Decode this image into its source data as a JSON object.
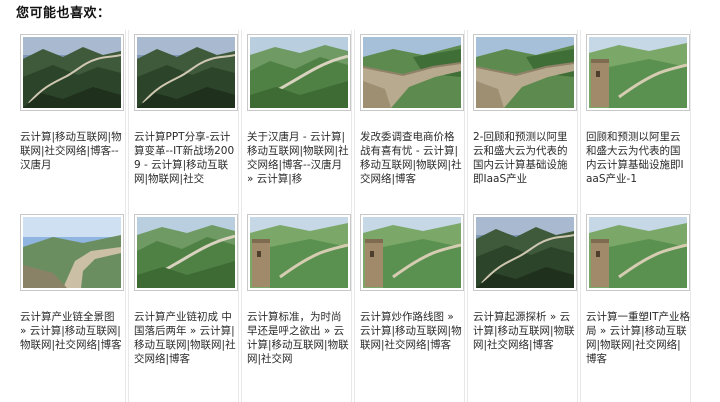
{
  "section": {
    "title": "您可能也喜欢："
  },
  "rows": [
    [
      {
        "scene": "wall-dark-valley",
        "caption": "云计算|移动互联网|物联网|社交网络|博客--汉唐月"
      },
      {
        "scene": "wall-dark-valley",
        "caption": "云计算PPT分享-云计算变革--IT新战场2009 - 云计算|移动互联网|物联网|社交"
      },
      {
        "scene": "wall-green-ridge",
        "caption": "关于汉唐月 - 云计算|移动互联网|物联网|社交网络|博客--汉唐月 » 云计算|移"
      },
      {
        "scene": "wall-stone-close",
        "caption": "发改委调查电商价格战有喜有忧 - 云计算|移动互联网|物联网|社交网络|博客"
      },
      {
        "scene": "wall-stone-close",
        "caption": "2-回顾和预测以阿里云和盛大云为代表的国内云计算基础设施即IaaS产业"
      },
      {
        "scene": "wall-tower-green",
        "caption": "回顾和预测以阿里云和盛大云为代表的国内云计算基础设施即IaaS产业-1"
      }
    ],
    [
      {
        "scene": "wall-walkway",
        "caption": "云计算产业链全景图 » 云计算|移动互联网|物联网|社交网络|博客"
      },
      {
        "scene": "wall-green-ridge",
        "caption": "云计算产业链初成 中国落后两年 » 云计算|移动互联网|物联网|社交网络|博客"
      },
      {
        "scene": "wall-tower-green",
        "caption": "云计算标准，为时尚早还是呼之欲出 » 云计算|移动互联网|物联网|社交网"
      },
      {
        "scene": "wall-tower-green",
        "caption": "云计算炒作路线图 » 云计算|移动互联网|物联网|社交网络|博客"
      },
      {
        "scene": "wall-dark-valley",
        "caption": "云计算起源探析 » 云计算|移动互联网|物联网|社交网络|博客"
      },
      {
        "scene": "wall-tower-green",
        "caption": "云计算一重塑IT产业格局 » 云计算|移动互联网|物联网|社交网络|博客"
      }
    ]
  ]
}
